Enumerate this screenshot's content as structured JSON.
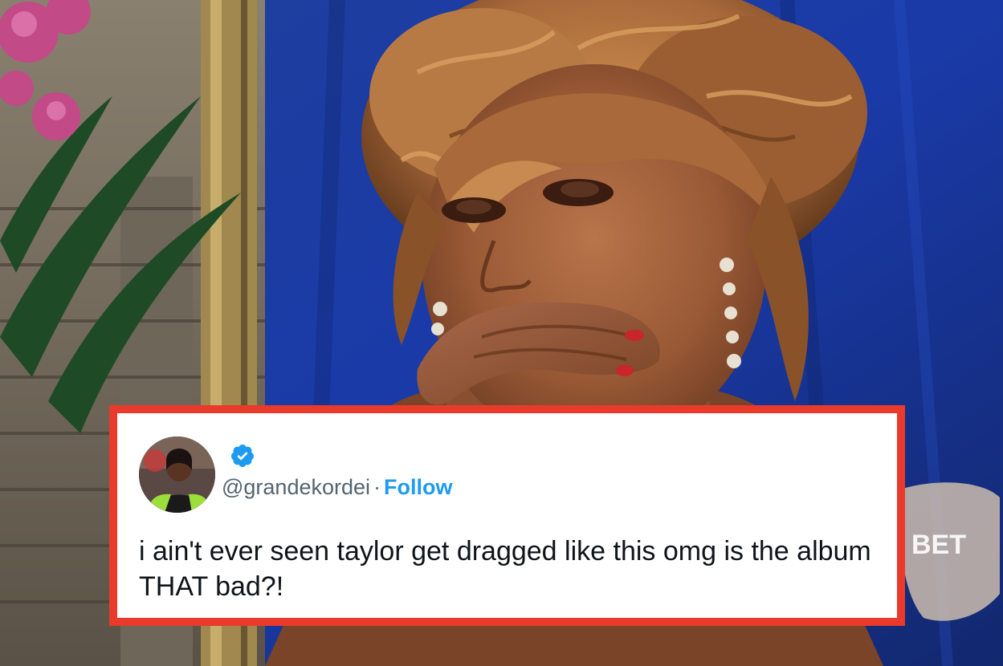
{
  "tweet": {
    "handle": "@grandekordei",
    "separator": "·",
    "follow_label": "Follow",
    "text": "i ain't ever seen taylor get dragged like this omg is the album THAT bad?!",
    "verified_icon": "verified-badge-icon"
  },
  "background": {
    "watermark_text": "BET"
  },
  "colors": {
    "frame_red": "#ea3a2c",
    "follow_blue": "#1d9bf0",
    "handle_gray": "#536471",
    "text_black": "#0f1419",
    "backdrop_blue": "#1b3fa8"
  }
}
